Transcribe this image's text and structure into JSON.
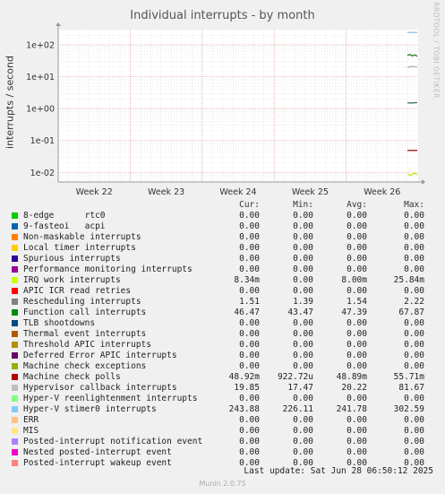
{
  "chart_data": {
    "type": "line",
    "title": "Individual interrupts - by month",
    "ylabel": "interrupts / second",
    "yscale": "log",
    "ylim": [
      0.005,
      300
    ],
    "yticks": [
      0.01,
      0.1,
      1,
      10,
      100
    ],
    "ytick_labels": [
      "1e-02",
      "1e-01",
      "1e+00",
      "1e+01",
      "1e+02"
    ],
    "xticks": [
      "Week 22",
      "Week 23",
      "Week 24",
      "Week 25",
      "Week 26"
    ],
    "series": [
      {
        "name": "Function call interrupts",
        "color": "#1a7a1a",
        "values": [
          46.5,
          50,
          45,
          48,
          44
        ]
      },
      {
        "name": "Hyper-V stimer0 interrupts",
        "color": "#8ab8f0",
        "values": [
          243.88,
          245,
          242
        ]
      },
      {
        "name": "Hypervisor callback interrupts",
        "color": "#aaaaaa",
        "values": [
          19.85,
          21,
          20
        ]
      },
      {
        "name": "Rescheduling interrupts",
        "color": "#2a6a5a",
        "values": [
          1.51,
          1.5,
          1.55
        ]
      },
      {
        "name": "Machine check polls",
        "color": "#8a0000",
        "values": [
          0.0489,
          0.0489,
          0.0489
        ]
      },
      {
        "name": "IRQ work interrupts",
        "color": "#c8e000",
        "values": [
          0.009,
          0.008,
          0.0095,
          0.0085
        ]
      }
    ]
  },
  "side_text": "RRDTOOL / TOBI OETIKER",
  "legend": {
    "headers": [
      "Cur:",
      "Min:",
      "Avg:",
      "Max:"
    ],
    "rows": [
      {
        "label": "8-edge      rtc0",
        "color": "#00cc00",
        "cur": "0.00",
        "min": "0.00",
        "avg": "0.00",
        "max": "0.00"
      },
      {
        "label": "9-fasteoi   acpi",
        "color": "#0066b3",
        "cur": "0.00",
        "min": "0.00",
        "avg": "0.00",
        "max": "0.00"
      },
      {
        "label": "Non-maskable interrupts",
        "color": "#ff8000",
        "cur": "0.00",
        "min": "0.00",
        "avg": "0.00",
        "max": "0.00"
      },
      {
        "label": "Local timer interrupts",
        "color": "#ffcc00",
        "cur": "0.00",
        "min": "0.00",
        "avg": "0.00",
        "max": "0.00"
      },
      {
        "label": "Spurious interrupts",
        "color": "#330099",
        "cur": "0.00",
        "min": "0.00",
        "avg": "0.00",
        "max": "0.00"
      },
      {
        "label": "Performance monitoring interrupts",
        "color": "#990099",
        "cur": "0.00",
        "min": "0.00",
        "avg": "0.00",
        "max": "0.00"
      },
      {
        "label": "IRQ work interrupts",
        "color": "#ccff00",
        "cur": "8.34m",
        "min": "0.00",
        "avg": "8.00m",
        "max": "25.84m"
      },
      {
        "label": "APIC ICR read retries",
        "color": "#ff0000",
        "cur": "0.00",
        "min": "0.00",
        "avg": "0.00",
        "max": "0.00"
      },
      {
        "label": "Rescheduling interrupts",
        "color": "#808080",
        "cur": "1.51",
        "min": "1.39",
        "avg": "1.54",
        "max": "2.22"
      },
      {
        "label": "Function call interrupts",
        "color": "#008f00",
        "cur": "46.47",
        "min": "43.47",
        "avg": "47.39",
        "max": "67.87"
      },
      {
        "label": "TLB shootdowns",
        "color": "#00487d",
        "cur": "0.00",
        "min": "0.00",
        "avg": "0.00",
        "max": "0.00"
      },
      {
        "label": "Thermal event interrupts",
        "color": "#b35a00",
        "cur": "0.00",
        "min": "0.00",
        "avg": "0.00",
        "max": "0.00"
      },
      {
        "label": "Threshold APIC interrupts",
        "color": "#b38f00",
        "cur": "0.00",
        "min": "0.00",
        "avg": "0.00",
        "max": "0.00"
      },
      {
        "label": "Deferred Error APIC interrupts",
        "color": "#6b006b",
        "cur": "0.00",
        "min": "0.00",
        "avg": "0.00",
        "max": "0.00"
      },
      {
        "label": "Machine check exceptions",
        "color": "#8fb300",
        "cur": "0.00",
        "min": "0.00",
        "avg": "0.00",
        "max": "0.00"
      },
      {
        "label": "Machine check polls",
        "color": "#b30000",
        "cur": "48.92m",
        "min": "922.72u",
        "avg": "48.89m",
        "max": "55.71m"
      },
      {
        "label": "Hypervisor callback interrupts",
        "color": "#bebebe",
        "cur": "19.85",
        "min": "17.47",
        "avg": "20.22",
        "max": "81.67"
      },
      {
        "label": "Hyper-V reenlightenment interrupts",
        "color": "#80ff80",
        "cur": "0.00",
        "min": "0.00",
        "avg": "0.00",
        "max": "0.00"
      },
      {
        "label": "Hyper-V stimer0 interrupts",
        "color": "#80c9ff",
        "cur": "243.88",
        "min": "226.11",
        "avg": "241.78",
        "max": "302.59"
      },
      {
        "label": "ERR",
        "color": "#ffc080",
        "cur": "0.00",
        "min": "0.00",
        "avg": "0.00",
        "max": "0.00"
      },
      {
        "label": "MIS",
        "color": "#ffe680",
        "cur": "0.00",
        "min": "0.00",
        "avg": "0.00",
        "max": "0.00"
      },
      {
        "label": "Posted-interrupt notification event",
        "color": "#aa80ff",
        "cur": "0.00",
        "min": "0.00",
        "avg": "0.00",
        "max": "0.00"
      },
      {
        "label": "Nested posted-interrupt event",
        "color": "#ee00cc",
        "cur": "0.00",
        "min": "0.00",
        "avg": "0.00",
        "max": "0.00"
      },
      {
        "label": "Posted-interrupt wakeup event",
        "color": "#ff8080",
        "cur": "0.00",
        "min": "0.00",
        "avg": "0.00",
        "max": "0.00"
      }
    ]
  },
  "footer": {
    "last_update": "Last update: Sat Jun 28 06:50:12 2025",
    "munin": "Munin 2.0.75"
  }
}
